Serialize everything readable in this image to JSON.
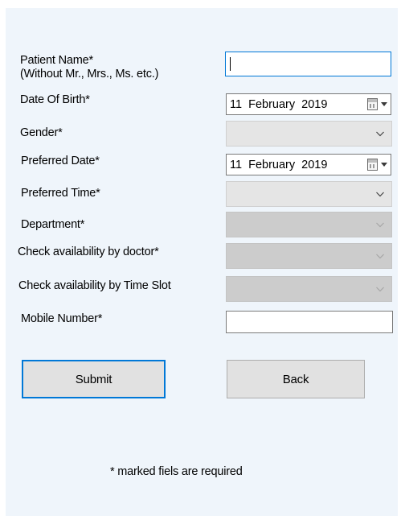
{
  "form": {
    "patient_name_label": "Patient Name*",
    "patient_name_sublabel": "(Without Mr., Mrs., Ms. etc.)",
    "patient_name_value": "",
    "dob_label": "Date Of Birth*",
    "dob_value": "11  February  2019",
    "gender_label": "Gender*",
    "gender_value": "",
    "preferred_date_label": "Preferred Date*",
    "preferred_date_value": "11  February  2019",
    "preferred_time_label": "Preferred Time*",
    "preferred_time_value": "",
    "department_label": "Department*",
    "department_value": "",
    "doctor_label": "Check availability by doctor*",
    "doctor_value": "",
    "timeslot_label": "Check availability by Time Slot",
    "timeslot_value": "",
    "mobile_label": "Mobile Number*",
    "mobile_value": ""
  },
  "buttons": {
    "submit_label": "Submit",
    "back_label": "Back"
  },
  "footnote": "* marked fiels are required",
  "icons": {
    "calendar": "calendar-icon",
    "dropdown": "chevron-down-icon"
  },
  "colors": {
    "panel_bg": "#eff5fb",
    "focus_border": "#0078d7",
    "disabled_combo": "#cccccc",
    "enabled_combo": "#e5e5e5",
    "button_bg": "#e1e1e1"
  }
}
